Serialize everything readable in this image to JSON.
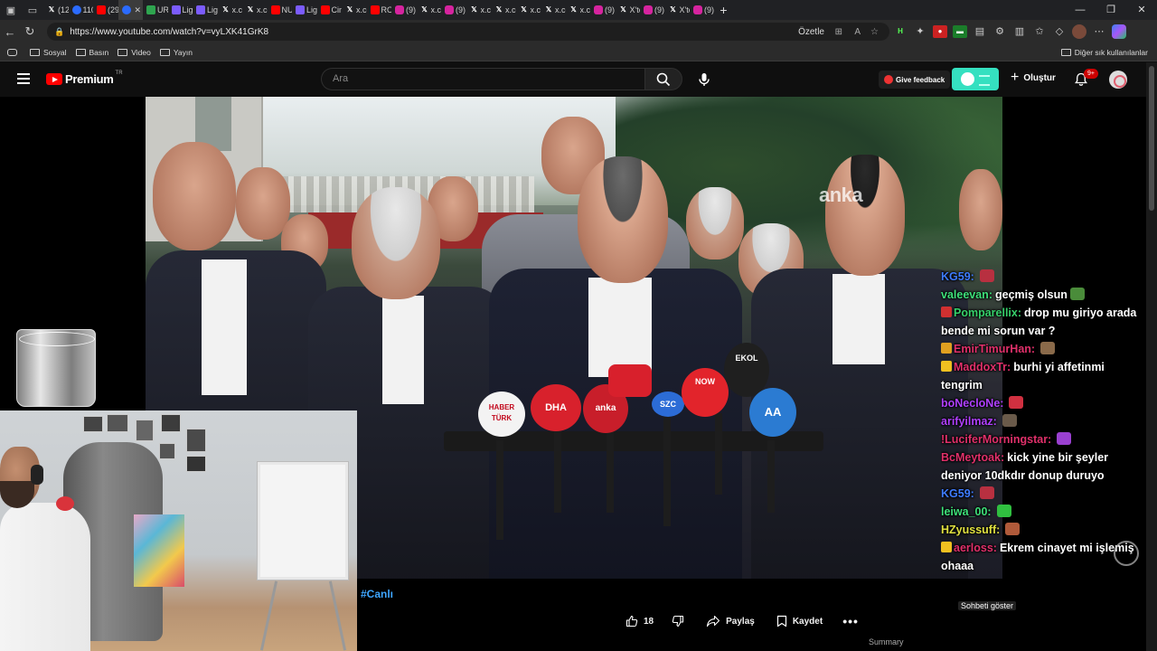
{
  "browser": {
    "tabs": [
      {
        "icon": "x",
        "title": "(12)"
      },
      {
        "icon": "bl",
        "title": "110"
      },
      {
        "icon": "yt",
        "title": "(296"
      },
      {
        "icon": "bl",
        "title": ""
      },
      {
        "icon": "gr",
        "title": "URL"
      },
      {
        "icon": "ln",
        "title": "Ligh"
      },
      {
        "icon": "ln",
        "title": "Ligh"
      },
      {
        "icon": "x",
        "title": "x.co"
      },
      {
        "icon": "x",
        "title": "x.co"
      },
      {
        "icon": "yt",
        "title": "NUR"
      },
      {
        "icon": "ln",
        "title": "Ligh"
      },
      {
        "icon": "yt",
        "title": "Cim"
      },
      {
        "icon": "x",
        "title": "x.co"
      },
      {
        "icon": "yt",
        "title": "ROP"
      },
      {
        "icon": "ig",
        "title": "(9) I"
      },
      {
        "icon": "x",
        "title": "x.co"
      },
      {
        "icon": "ig",
        "title": "(9) I"
      },
      {
        "icon": "x",
        "title": "x.co"
      },
      {
        "icon": "x",
        "title": "x.co"
      },
      {
        "icon": "x",
        "title": "x.co"
      },
      {
        "icon": "x",
        "title": "x.co"
      },
      {
        "icon": "x",
        "title": "x.co"
      },
      {
        "icon": "ig",
        "title": "(9) I"
      },
      {
        "icon": "x",
        "title": "X'te"
      },
      {
        "icon": "ig",
        "title": "(9) I"
      },
      {
        "icon": "x",
        "title": "X'te"
      },
      {
        "icon": "ig",
        "title": "(9) I"
      }
    ],
    "url": "https://www.youtube.com/watch?v=vyLXK41GrK8",
    "summarize_label": "Özetle",
    "bookmarks": [
      "Sosyal",
      "Basın",
      "Video",
      "Yayın"
    ],
    "other_bookmarks": "Diğer sık kullanılanlar"
  },
  "youtube": {
    "brand": "Premium",
    "country": "TR",
    "search_placeholder": "Ara",
    "feedback_label": "Give feedback",
    "create_label": "Oluştur",
    "notification_count": "9+"
  },
  "video": {
    "watermark": "anka",
    "mics": [
      "HABER TÜRK",
      "DHA",
      "anka",
      "SZC",
      "NOW",
      "EKOL",
      "AA"
    ]
  },
  "chat": [
    {
      "user": "KG59:",
      "color": "#3e7cff",
      "msg": "",
      "emote": "#b83040"
    },
    {
      "user": "valeevan:",
      "color": "#3ee07a",
      "msg": "geçmiş olsun",
      "emote": "#4a8c3a"
    },
    {
      "user": "Pomparellix:",
      "color": "#36d06a",
      "msg": "drop mu giriyo arada bende mi sorun var ?",
      "badge": "#d03030"
    },
    {
      "user": "EmirTimurHan:",
      "color": "#e0306a",
      "msg": "",
      "emote": "#8a6a4a",
      "badge": "#e0a020"
    },
    {
      "user": "MaddoxTr:",
      "color": "#e0306a",
      "msg": "burhi yi affetinmi tengrim",
      "badge": "#f0c020"
    },
    {
      "user": "boNecloNe:",
      "color": "#b040ff",
      "msg": "",
      "emote": "#d03040"
    },
    {
      "user": "arifyilmaz:",
      "color": "#b040ff",
      "msg": "",
      "emote": "#6a5a4a"
    },
    {
      "user": "!LuciferMorningstar:",
      "color": "#e0306a",
      "msg": "",
      "emote": "#9a40d0"
    },
    {
      "user": "BcMeytoak:",
      "color": "#e0306a",
      "msg": "kick yine bir şeyler deniyor 10dkdır donup duruyo"
    },
    {
      "user": "KG59:",
      "color": "#3e7cff",
      "msg": "",
      "emote": "#b83040"
    },
    {
      "user": "leiwa_00:",
      "color": "#3ee07a",
      "msg": "",
      "emote": "#30c040"
    },
    {
      "user": "HZyussuff:",
      "color": "#e0e040",
      "msg": "",
      "emote": "#b05a3a"
    },
    {
      "user": "aerloss:",
      "color": "#e0306a",
      "msg": "Ekrem cinayet mi işlemiş ohaaa",
      "badge": "#f0c020"
    }
  ],
  "meta": {
    "live_tag": "#Canlı",
    "likes": "18",
    "share_label": "Paylaş",
    "save_label": "Kaydet",
    "summary_label": "Summary",
    "chat_tooltip": "Sohbeti göster"
  },
  "colors": {
    "accent_live": "#3ea6ff",
    "yt_red": "#ff0000",
    "toggle": "#35e0c0"
  }
}
